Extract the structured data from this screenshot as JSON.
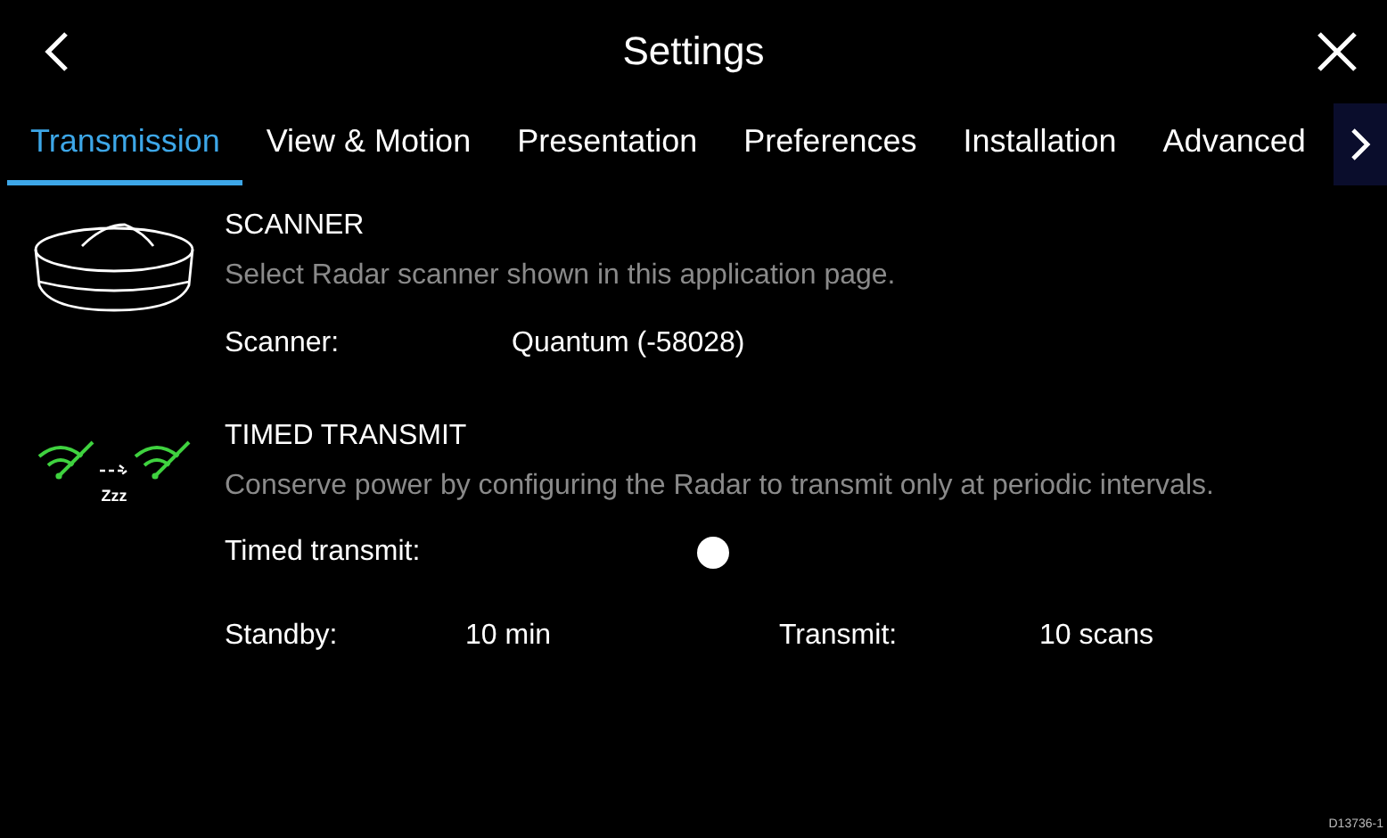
{
  "window": {
    "title": "Settings"
  },
  "tabs": [
    {
      "label": "Transmission",
      "selected": true
    },
    {
      "label": "View & Motion",
      "selected": false
    },
    {
      "label": "Presentation",
      "selected": false
    },
    {
      "label": "Preferences",
      "selected": false
    },
    {
      "label": "Installation",
      "selected": false
    },
    {
      "label": "Advanced",
      "selected": false
    }
  ],
  "scanner": {
    "heading": "SCANNER",
    "description": "Select Radar scanner shown in this application page.",
    "label": "Scanner:",
    "value": "Quantum (-58028)"
  },
  "timed_transmit": {
    "heading": "TIMED TRANSMIT",
    "description": "Conserve power by configuring the Radar to transmit only at periodic intervals.",
    "icon_caption": "Zzz",
    "toggle_label": "Timed transmit:",
    "on": false,
    "standby_label": "Standby:",
    "standby_value": "10 min",
    "transmit_label": "Transmit:",
    "transmit_value": "10 scans"
  },
  "footnote": "D13736-1"
}
